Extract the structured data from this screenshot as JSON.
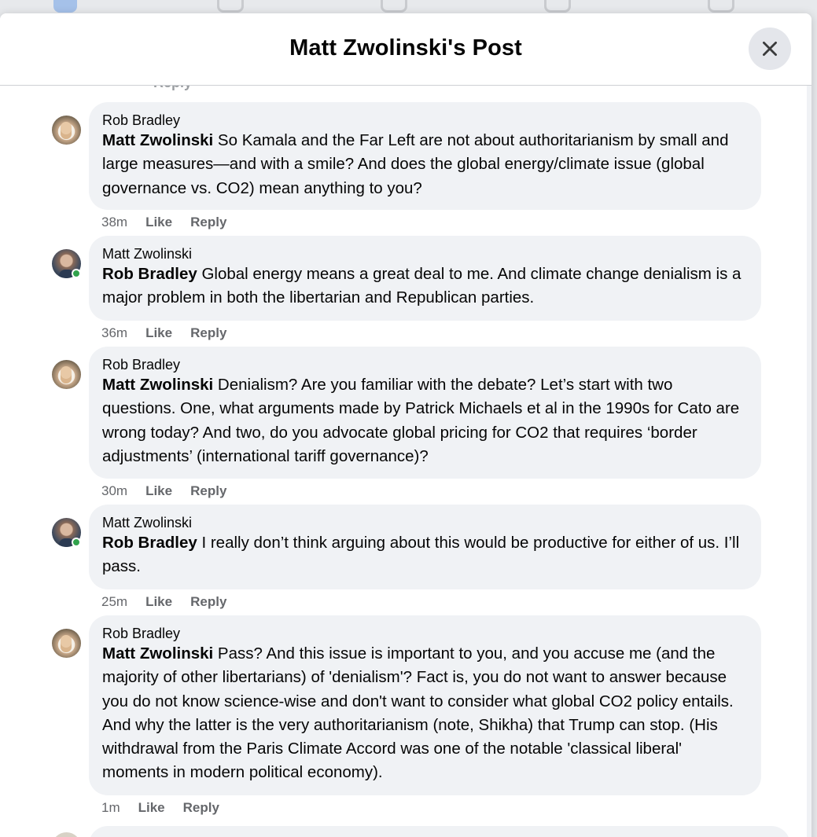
{
  "modal": {
    "title": "Matt Zwolinski's Post",
    "close_icon": "close-icon"
  },
  "prev_fragment": "Reply",
  "comments": [
    {
      "author": "Rob Bradley",
      "avatar": "rob",
      "online": false,
      "mention": "Matt Zwolinski",
      "body": " So Kamala and the Far Left are not about authoritarianism by small and large measures—and with a smile? And does the global energy/climate issue (global governance vs. CO2) mean anything to you?",
      "time": "38m",
      "like": "Like",
      "reply": "Reply"
    },
    {
      "author": "Matt Zwolinski",
      "avatar": "matt",
      "online": true,
      "mention": "Rob Bradley",
      "body": " Global energy means a great deal to me. And climate change denialism is a major problem in both the libertarian and Republican parties.",
      "time": "36m",
      "like": "Like",
      "reply": "Reply"
    },
    {
      "author": "Rob Bradley",
      "avatar": "rob",
      "online": false,
      "mention": "Matt Zwolinski",
      "body": " Denialism? Are you familiar with the debate? Let’s start with two questions. One, what arguments made by Patrick Michaels et al in the 1990s for Cato are wrong today? And two, do you advocate global pricing for CO2 that requires ‘border adjustments’ (international tariff governance)?",
      "time": "30m",
      "like": "Like",
      "reply": "Reply"
    },
    {
      "author": "Matt Zwolinski",
      "avatar": "matt",
      "online": true,
      "mention": "Rob Bradley",
      "body": " I really don’t think arguing about this would be productive for either of us. I’ll pass.",
      "time": "25m",
      "like": "Like",
      "reply": "Reply"
    },
    {
      "author": "Rob Bradley",
      "avatar": "rob",
      "online": false,
      "mention": "Matt Zwolinski",
      "body": " Pass? And this issue is important to you, and you accuse me (and the majority of other libertarians) of 'denialism'? Fact is, you do not want to answer because you do not know science-wise and don't want to consider what global CO2 policy entails. And why the latter is the very authoritarianism (note, Shikha) that Trump can stop. (His withdrawal from the Paris Climate Accord was one of the notable 'classical liberal' moments in modern political economy).",
      "time": "1m",
      "like": "Like",
      "reply": "Reply"
    }
  ]
}
